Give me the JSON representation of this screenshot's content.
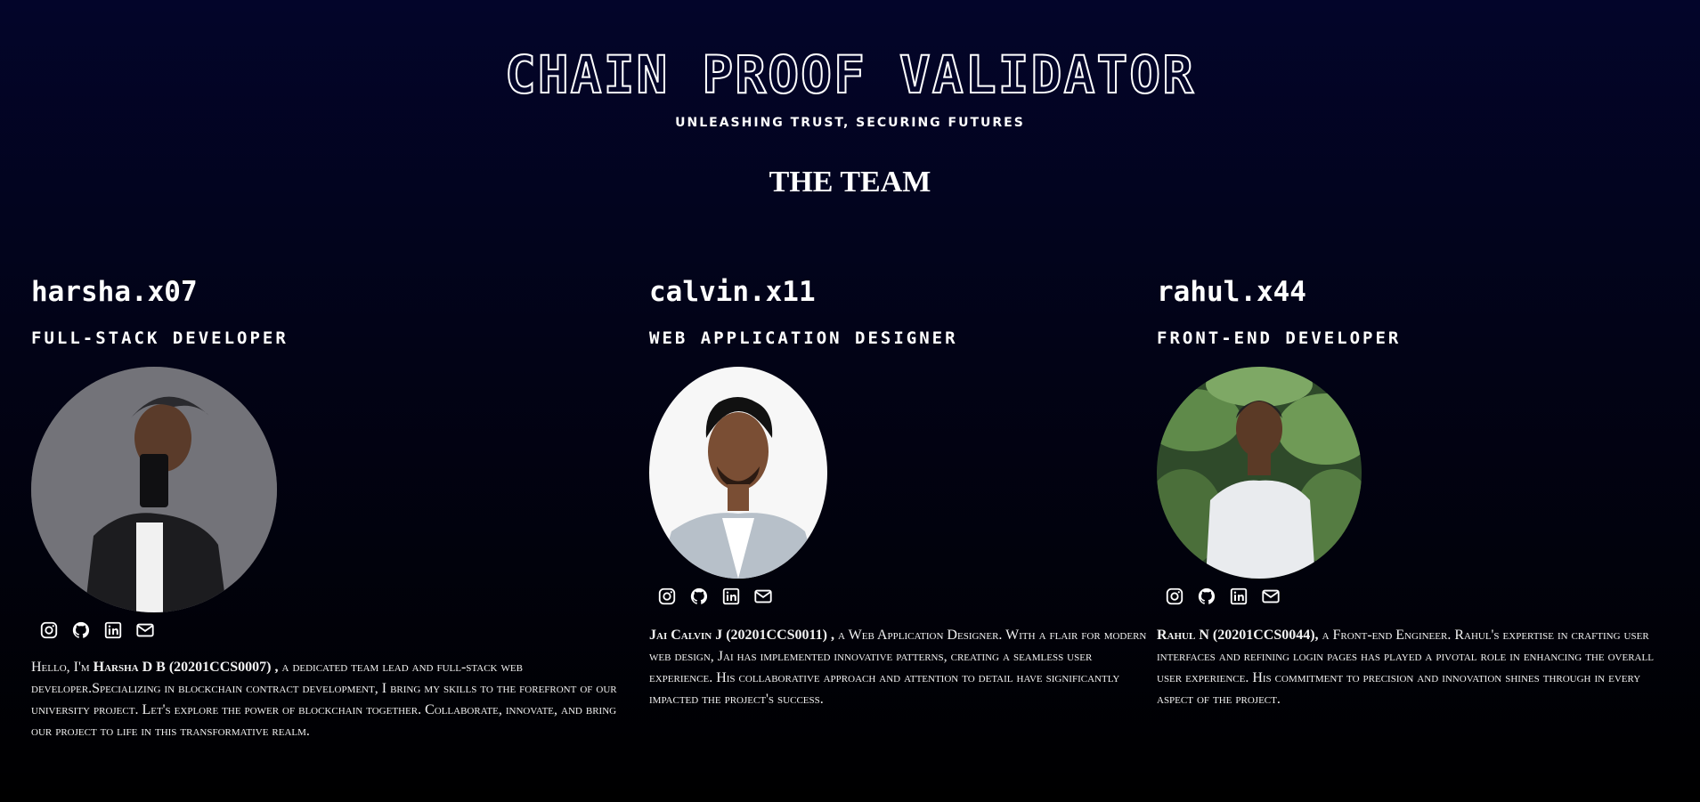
{
  "header": {
    "title": "CHAIN PROOF VALIDATOR",
    "tagline": "UNLEASHING TRUST, SECURING FUTURES"
  },
  "team": {
    "heading": "THE TEAM",
    "members": [
      {
        "handle": "harsha.x07",
        "role": "FULL-STACK DEVELOPER",
        "bio_prefix": "Hello, I'm ",
        "bio_name": "Harsha D B (20201CCS0007) ,",
        "bio_text": " a dedicated team lead and full-stack web developer.Specializing in blockchain contract development, I bring my skills to the forefront of our university project. Let's explore the power of blockchain together. Collaborate, innovate, and bring our project to life in this transformative realm."
      },
      {
        "handle": "calvin.x11",
        "role": "WEB APPLICATION DESIGNER",
        "bio_prefix": "",
        "bio_name": "Jai Calvin J (20201CCS0011) ,",
        "bio_text": " a Web Application Designer. With a flair for modern web design, Jai has implemented innovative patterns, creating a seamless user experience. His collaborative approach and attention to detail have significantly impacted the project's success."
      },
      {
        "handle": "rahul.x44",
        "role": "FRONT-END DEVELOPER",
        "bio_prefix": "",
        "bio_name": "Rahul N (20201CCS0044),",
        "bio_text": " a Front-end Engineer. Rahul's expertise in crafting user interfaces and refining login pages has played a pivotal role in enhancing the overall user experience. His commitment to precision and innovation shines through in every aspect of the project."
      }
    ]
  },
  "social_icons": [
    "instagram-icon",
    "github-icon",
    "linkedin-icon",
    "mail-icon"
  ]
}
